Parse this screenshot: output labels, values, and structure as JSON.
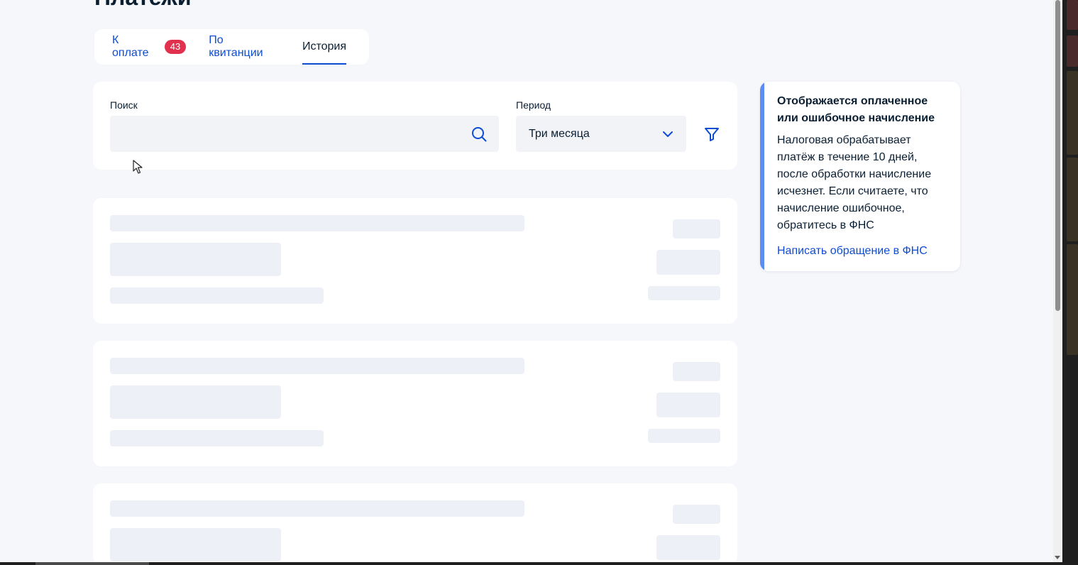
{
  "page": {
    "title": "Платежи"
  },
  "tabs": [
    {
      "label": "К оплате",
      "badge": "43"
    },
    {
      "label": "По квитанции"
    },
    {
      "label": "История"
    }
  ],
  "filters": {
    "search_label": "Поиск",
    "search_value": "",
    "period_label": "Период",
    "period_value": "Три месяца"
  },
  "info": {
    "title": "Отображается оплаченное или ошибочное начисление",
    "text": "Налоговая обрабатывает платёж в течение 10 дней, после обработки начисление исчезнет. Если считаете, что начисление ошибочное, обратитесь в ФНС",
    "link": "Написать обращение в ФНС"
  },
  "colors": {
    "accent": "#0d4cd3",
    "badge": "#e2304f",
    "info_bar": "#5b8df5",
    "skeleton": "#edf0f7"
  }
}
